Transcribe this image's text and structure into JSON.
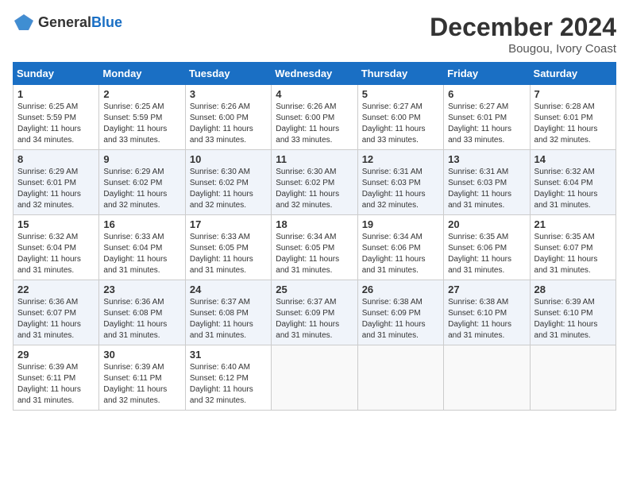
{
  "header": {
    "logo_general": "General",
    "logo_blue": "Blue",
    "month_title": "December 2024",
    "location": "Bougou, Ivory Coast"
  },
  "weekdays": [
    "Sunday",
    "Monday",
    "Tuesday",
    "Wednesday",
    "Thursday",
    "Friday",
    "Saturday"
  ],
  "weeks": [
    [
      {
        "day": "1",
        "sunrise": "6:25 AM",
        "sunset": "5:59 PM",
        "daylight": "11 hours and 34 minutes."
      },
      {
        "day": "2",
        "sunrise": "6:25 AM",
        "sunset": "5:59 PM",
        "daylight": "11 hours and 33 minutes."
      },
      {
        "day": "3",
        "sunrise": "6:26 AM",
        "sunset": "6:00 PM",
        "daylight": "11 hours and 33 minutes."
      },
      {
        "day": "4",
        "sunrise": "6:26 AM",
        "sunset": "6:00 PM",
        "daylight": "11 hours and 33 minutes."
      },
      {
        "day": "5",
        "sunrise": "6:27 AM",
        "sunset": "6:00 PM",
        "daylight": "11 hours and 33 minutes."
      },
      {
        "day": "6",
        "sunrise": "6:27 AM",
        "sunset": "6:01 PM",
        "daylight": "11 hours and 33 minutes."
      },
      {
        "day": "7",
        "sunrise": "6:28 AM",
        "sunset": "6:01 PM",
        "daylight": "11 hours and 32 minutes."
      }
    ],
    [
      {
        "day": "8",
        "sunrise": "6:29 AM",
        "sunset": "6:01 PM",
        "daylight": "11 hours and 32 minutes."
      },
      {
        "day": "9",
        "sunrise": "6:29 AM",
        "sunset": "6:02 PM",
        "daylight": "11 hours and 32 minutes."
      },
      {
        "day": "10",
        "sunrise": "6:30 AM",
        "sunset": "6:02 PM",
        "daylight": "11 hours and 32 minutes."
      },
      {
        "day": "11",
        "sunrise": "6:30 AM",
        "sunset": "6:02 PM",
        "daylight": "11 hours and 32 minutes."
      },
      {
        "day": "12",
        "sunrise": "6:31 AM",
        "sunset": "6:03 PM",
        "daylight": "11 hours and 32 minutes."
      },
      {
        "day": "13",
        "sunrise": "6:31 AM",
        "sunset": "6:03 PM",
        "daylight": "11 hours and 31 minutes."
      },
      {
        "day": "14",
        "sunrise": "6:32 AM",
        "sunset": "6:04 PM",
        "daylight": "11 hours and 31 minutes."
      }
    ],
    [
      {
        "day": "15",
        "sunrise": "6:32 AM",
        "sunset": "6:04 PM",
        "daylight": "11 hours and 31 minutes."
      },
      {
        "day": "16",
        "sunrise": "6:33 AM",
        "sunset": "6:04 PM",
        "daylight": "11 hours and 31 minutes."
      },
      {
        "day": "17",
        "sunrise": "6:33 AM",
        "sunset": "6:05 PM",
        "daylight": "11 hours and 31 minutes."
      },
      {
        "day": "18",
        "sunrise": "6:34 AM",
        "sunset": "6:05 PM",
        "daylight": "11 hours and 31 minutes."
      },
      {
        "day": "19",
        "sunrise": "6:34 AM",
        "sunset": "6:06 PM",
        "daylight": "11 hours and 31 minutes."
      },
      {
        "day": "20",
        "sunrise": "6:35 AM",
        "sunset": "6:06 PM",
        "daylight": "11 hours and 31 minutes."
      },
      {
        "day": "21",
        "sunrise": "6:35 AM",
        "sunset": "6:07 PM",
        "daylight": "11 hours and 31 minutes."
      }
    ],
    [
      {
        "day": "22",
        "sunrise": "6:36 AM",
        "sunset": "6:07 PM",
        "daylight": "11 hours and 31 minutes."
      },
      {
        "day": "23",
        "sunrise": "6:36 AM",
        "sunset": "6:08 PM",
        "daylight": "11 hours and 31 minutes."
      },
      {
        "day": "24",
        "sunrise": "6:37 AM",
        "sunset": "6:08 PM",
        "daylight": "11 hours and 31 minutes."
      },
      {
        "day": "25",
        "sunrise": "6:37 AM",
        "sunset": "6:09 PM",
        "daylight": "11 hours and 31 minutes."
      },
      {
        "day": "26",
        "sunrise": "6:38 AM",
        "sunset": "6:09 PM",
        "daylight": "11 hours and 31 minutes."
      },
      {
        "day": "27",
        "sunrise": "6:38 AM",
        "sunset": "6:10 PM",
        "daylight": "11 hours and 31 minutes."
      },
      {
        "day": "28",
        "sunrise": "6:39 AM",
        "sunset": "6:10 PM",
        "daylight": "11 hours and 31 minutes."
      }
    ],
    [
      {
        "day": "29",
        "sunrise": "6:39 AM",
        "sunset": "6:11 PM",
        "daylight": "11 hours and 31 minutes."
      },
      {
        "day": "30",
        "sunrise": "6:39 AM",
        "sunset": "6:11 PM",
        "daylight": "11 hours and 32 minutes."
      },
      {
        "day": "31",
        "sunrise": "6:40 AM",
        "sunset": "6:12 PM",
        "daylight": "11 hours and 32 minutes."
      },
      null,
      null,
      null,
      null
    ]
  ]
}
